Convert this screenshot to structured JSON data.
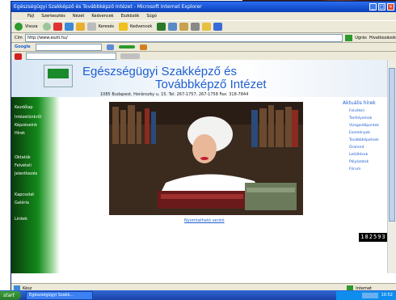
{
  "window": {
    "title": "Egészségügyi Szakképző és Továbbképző Intézet - Microsoft Internet Explorer"
  },
  "menu": [
    "Fájl",
    "Szerkesztés",
    "Nézet",
    "Kedvencek",
    "Eszközök",
    "Súgó"
  ],
  "toolbar": {
    "back_label": "Vissza",
    "search_label": "Keresés",
    "favorites_label": "Kedvencek"
  },
  "address": {
    "label": "Cím",
    "value": "http://www.eszti.hu/",
    "go_label": "Ugrás"
  },
  "links_label": "Hivatkozások",
  "google": {
    "label": "Google"
  },
  "site": {
    "title_line1": "Egészségügyi Szakképző és",
    "title_line2": "Továbbképző Intézet",
    "address": "1085 Budapest, Horánszky u. 15. Tel: 267-1757, 267-1758 Fax: 318-7844",
    "nav": [
      "Kezdőlap",
      "Intézetünkről",
      "Képzéseink",
      "Hírek",
      "Oktatók",
      "Felvételi",
      "Jelentkezés",
      "Kapcsolat",
      "Galéria",
      "Linkek"
    ],
    "photo_caption": "Nyomtatható verzió",
    "right_title": "Aktuális hírek",
    "right_links": [
      "Felvételi",
      "Tanfolyamok",
      "Vizsgaidőpontok",
      "Események",
      "Továbbképzések",
      "Órarend",
      "Letöltések",
      "Pályázatok",
      "Fórum"
    ],
    "counter": "182593"
  },
  "status": {
    "text": "Kész",
    "zone": "Internet"
  },
  "taskbar": {
    "start_label": "start",
    "task_item": "Egészségügyi Szakk...",
    "clock": "10:52"
  }
}
